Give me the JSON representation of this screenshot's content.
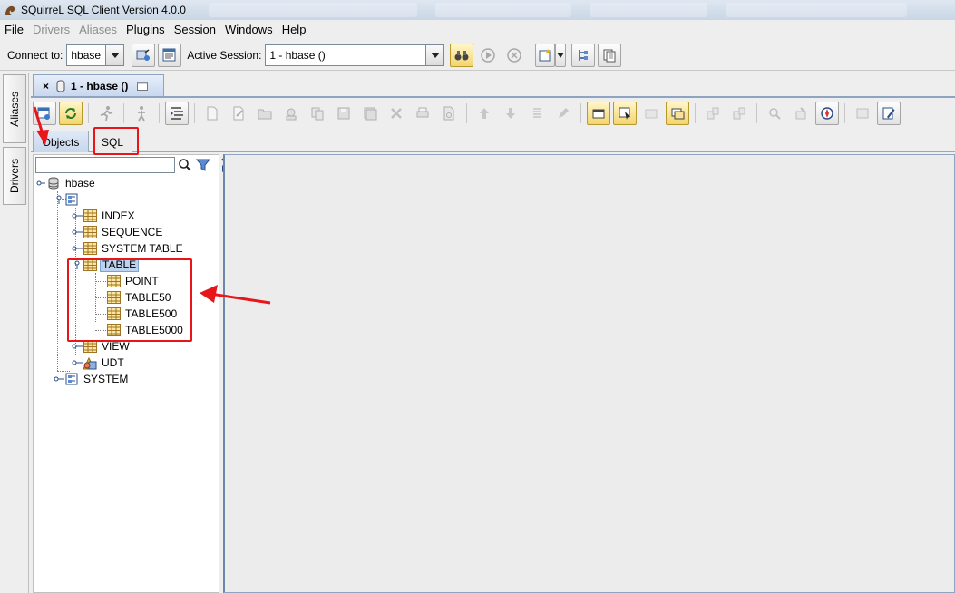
{
  "window": {
    "title": "SQuirreL SQL Client Version 4.0.0"
  },
  "menu": {
    "items": [
      {
        "label": "File",
        "disabled": false
      },
      {
        "label": "Drivers",
        "disabled": true
      },
      {
        "label": "Aliases",
        "disabled": true
      },
      {
        "label": "Plugins",
        "disabled": false
      },
      {
        "label": "Session",
        "disabled": false
      },
      {
        "label": "Windows",
        "disabled": false
      },
      {
        "label": "Help",
        "disabled": false
      }
    ]
  },
  "toolbar": {
    "connect_label": "Connect to:",
    "connect_value": "hbase",
    "active_session_label": "Active Session:",
    "active_session_value": "1 - hbase ()"
  },
  "side_tabs": {
    "aliases": "Aliases",
    "drivers": "Drivers"
  },
  "session": {
    "tab_title": "1 - hbase ()",
    "object_tabs": [
      {
        "label": "Objects",
        "active": true
      },
      {
        "label": "SQL",
        "active": false
      }
    ],
    "search": {
      "value": ""
    }
  },
  "tree": {
    "root": "hbase",
    "schema_unnamed": "",
    "folders": [
      "INDEX",
      "SEQUENCE",
      "SYSTEM TABLE",
      "TABLE",
      "VIEW",
      "UDT"
    ],
    "selected": "TABLE",
    "tables": [
      "POINT",
      "TABLE50",
      "TABLE500",
      "TABLE5000"
    ],
    "system": "SYSTEM"
  },
  "colors": {
    "annotation": "#e8151b",
    "selection": "#bcd2ee",
    "tab_active": "#c6d6ec"
  }
}
